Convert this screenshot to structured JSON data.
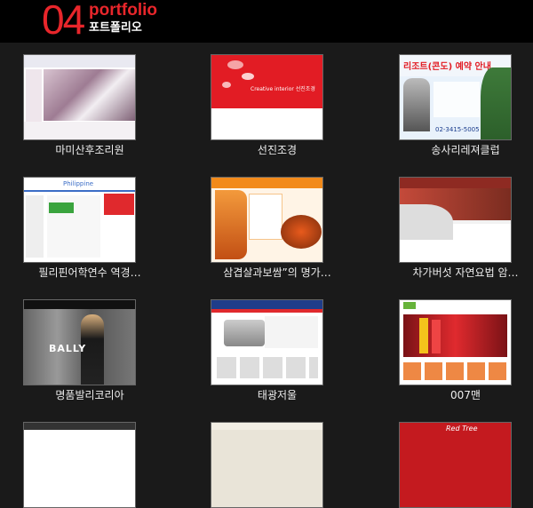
{
  "header": {
    "number": "04",
    "title_en": "portfolio",
    "title_ko": "포트폴리오"
  },
  "thumbnails": {
    "sunjin_label": "Creative interior 선진조경",
    "songsari_title": "리조트(콘도) 예약 안내",
    "songsari_phone": "02-3415-5005",
    "philippine_logo": "Philippine",
    "bally_label": "BALLY",
    "redtree_label": "Red Tree"
  },
  "portfolio": [
    {
      "label": "마미산후조리원"
    },
    {
      "label": "선진조경"
    },
    {
      "label": "송사리레져클럽"
    },
    {
      "label": "필리핀어학연수 역경…"
    },
    {
      "label": "삼겹살과보쌈”의 명가…"
    },
    {
      "label": "차가버섯 자연요법 암…"
    },
    {
      "label": "명품발리코리아"
    },
    {
      "label": "태광저울"
    },
    {
      "label": "007맨"
    }
  ]
}
